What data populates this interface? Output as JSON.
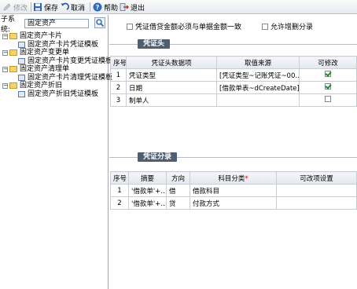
{
  "toolbar": {
    "modify": "修改",
    "save": "保存",
    "cancel": "取消",
    "help": "帮助",
    "exit": "退出"
  },
  "left": {
    "subsystem_label": "子系统:",
    "subsystem_value": "固定资产",
    "tree": [
      {
        "label": "固定资产卡片",
        "children": [
          "固定资产卡片凭证模板"
        ]
      },
      {
        "label": "固定资产变更单",
        "children": [
          "固定资产卡片变更凭证模板"
        ]
      },
      {
        "label": "固定资产清理单",
        "children": [
          "固定资产卡片清理凭证模板"
        ]
      },
      {
        "label": "固定资产折旧",
        "children": [
          "固定资产折旧凭证模板"
        ]
      }
    ]
  },
  "options": {
    "must_equal": {
      "label": "凭证借贷金额必须与单据金额一致",
      "checked": false
    },
    "allow_add_delete": {
      "label": "允许增删分录",
      "checked": false
    }
  },
  "header_section": {
    "title": "凭证头",
    "columns": [
      "序号",
      "凭证头数据项",
      "取值来源",
      "可修改"
    ],
    "rows": [
      {
        "no": "1",
        "item": "凭证类型",
        "source": "[凭证类型~记账凭证~00…",
        "editable": true
      },
      {
        "no": "2",
        "item": "日期",
        "source": "[借款单表~dCreateDate]",
        "editable": true
      },
      {
        "no": "3",
        "item": "制单人",
        "source": "",
        "editable": false
      }
    ]
  },
  "entry_section": {
    "title": "凭证分录",
    "columns": [
      "序号",
      "摘要",
      "方向",
      "科目分类",
      "可改项设置"
    ],
    "rows": [
      {
        "no": "1",
        "summary": "'借款单'+…",
        "direction": "借",
        "category": "借款科目",
        "setting": ""
      },
      {
        "no": "2",
        "summary": "'借款单'+…",
        "direction": "贷",
        "category": "付款方式",
        "setting": ""
      }
    ]
  },
  "colors": {
    "section_tab": "#4f5f73",
    "check_green": "#1e8b2e",
    "required": "#dd0000"
  }
}
